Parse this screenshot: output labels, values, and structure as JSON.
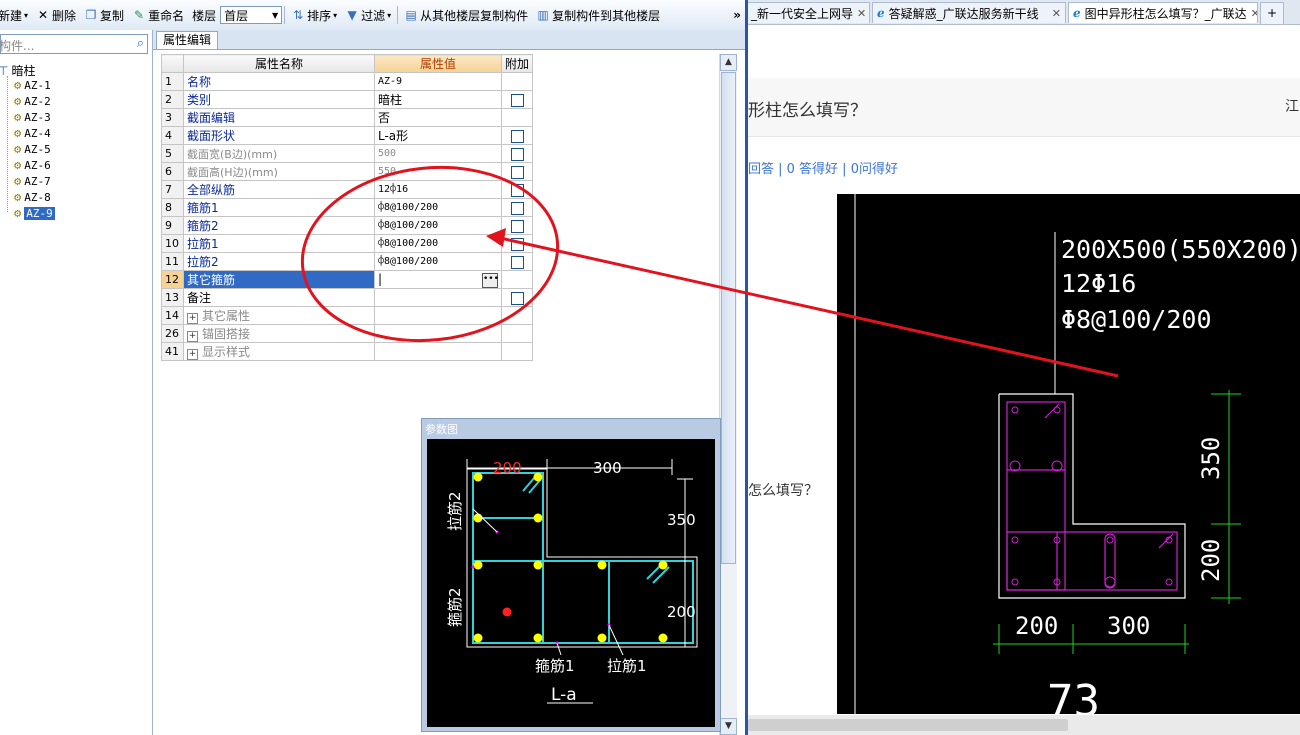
{
  "toolbar": {
    "new_label": "新建",
    "delete_label": "删除",
    "copy_label": "复制",
    "rename_label": "重命名",
    "floor_label": "楼层",
    "floor_value": "首层",
    "sort_label": "排序",
    "filter_label": "过滤",
    "copy_from_label": "从其他楼层复制构件",
    "copy_to_label": "复制构件到其他楼层",
    "more_label": "»"
  },
  "sidebar": {
    "search_placeholder": "构件...",
    "root_label": "暗柱",
    "items": [
      "AZ-1",
      "AZ-2",
      "AZ-3",
      "AZ-4",
      "AZ-5",
      "AZ-6",
      "AZ-7",
      "AZ-8",
      "AZ-9"
    ]
  },
  "panel": {
    "tab_label": "属性编辑",
    "headers": {
      "name": "属性名称",
      "value": "属性值",
      "extra": "附加"
    },
    "rows": [
      {
        "no": "1",
        "name": "名称",
        "value": "AZ-9"
      },
      {
        "no": "2",
        "name": "类别",
        "value": "暗柱"
      },
      {
        "no": "3",
        "name": "截面编辑",
        "value": "否"
      },
      {
        "no": "4",
        "name": "截面形状",
        "value": "L-a形"
      },
      {
        "no": "5",
        "name": "截面宽(B边)(mm)",
        "value": "500"
      },
      {
        "no": "6",
        "name": "截面高(H边)(mm)",
        "value": "550"
      },
      {
        "no": "7",
        "name": "全部纵筋",
        "value": "12⌽16"
      },
      {
        "no": "8",
        "name": "箍筋1",
        "value": "⌽8@100/200"
      },
      {
        "no": "9",
        "name": "箍筋2",
        "value": "⌽8@100/200"
      },
      {
        "no": "10",
        "name": "拉筋1",
        "value": "⌽8@100/200"
      },
      {
        "no": "11",
        "name": "拉筋2",
        "value": "⌽8@100/200"
      },
      {
        "no": "12",
        "name": "其它箍筋",
        "value": "|"
      },
      {
        "no": "13",
        "name": "备注",
        "value": ""
      },
      {
        "no": "14",
        "name": "其它属性",
        "value": ""
      },
      {
        "no": "26",
        "name": "锚固搭接",
        "value": ""
      },
      {
        "no": "41",
        "name": "显示样式",
        "value": ""
      }
    ]
  },
  "diagram": {
    "title": "参数图",
    "dim_top_left": "200",
    "dim_top_right": "300",
    "dim_right_top": "350",
    "dim_right_bottom": "200",
    "label_tie2": "拉筋2",
    "label_stirrup2": "箍筋2",
    "label_stirrup1": "箍筋1",
    "label_tie1": "拉筋1",
    "shape_name": "L-a"
  },
  "browser": {
    "tabs": [
      {
        "label": "_新一代安全上网导"
      },
      {
        "label": "答疑解惑_广联达服务新干线"
      },
      {
        "label": "图中异形柱怎么填写？_广联达"
      }
    ],
    "plus": "+",
    "question_title": "形柱怎么填写？",
    "header_right": "江",
    "stats": "回答 | 0 答得好 | 0问得好",
    "question_snippet": "怎么填写？"
  },
  "cad": {
    "size_text": "200X500(550X200)",
    "rebar_text": "12Φ16",
    "stirrup_text": "Φ8@100/200",
    "dim_350": "350",
    "dim_200_v": "200",
    "dim_200_h": "200",
    "dim_300_h": "300",
    "number": "73"
  },
  "colors": {
    "annotation_red": "#e0141e",
    "cad_magenta": "#d020d0",
    "cad_green": "#1fd11f",
    "diagram_cyan": "#33d0d8",
    "diagram_yellow": "#ffff00",
    "selection_blue": "#316ac5"
  }
}
